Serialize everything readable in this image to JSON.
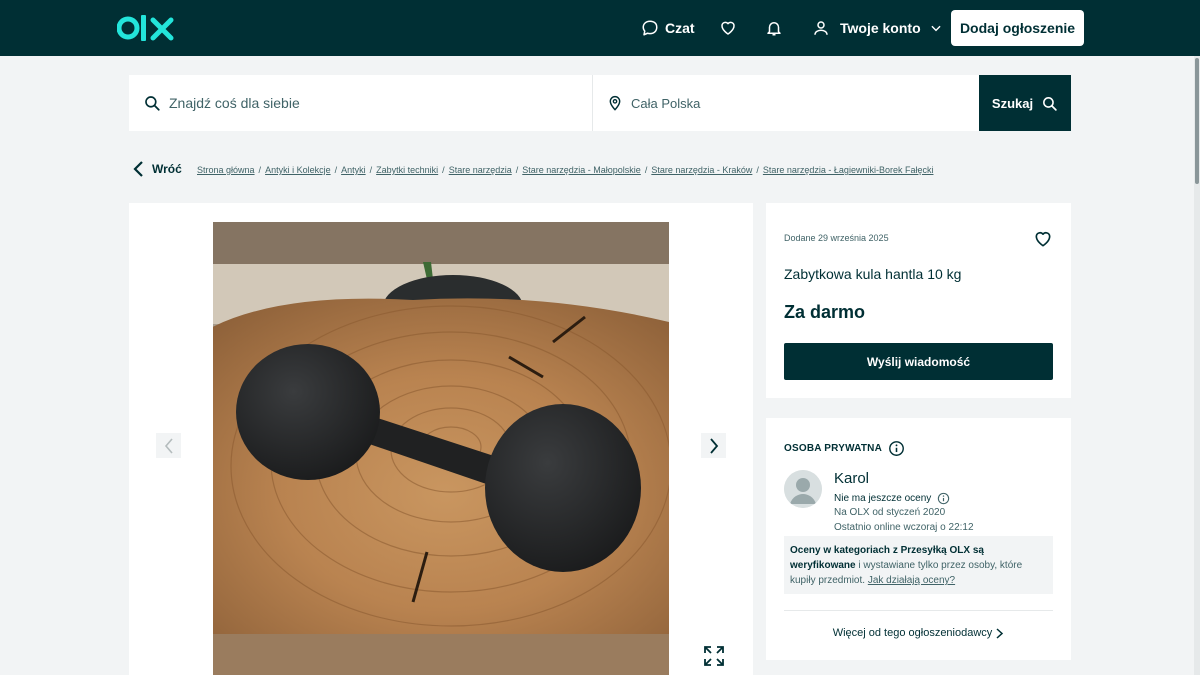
{
  "header": {
    "logo_text": "olx",
    "chat_label": "Czat",
    "account_label": "Twoje konto",
    "add_button_label": "Dodaj ogłoszenie",
    "icons": [
      "chat-icon",
      "heart-icon",
      "bell-icon",
      "user-icon",
      "chevron-down-icon"
    ]
  },
  "search": {
    "query_placeholder": "Znajdź coś dla siebie",
    "location_value": "Cała Polska",
    "button_label": "Szukaj"
  },
  "breadcrumb": {
    "back_label": "Wróć",
    "items": [
      "Strona główna",
      "Antyki i Kolekcje",
      "Antyki",
      "Zabytki techniki",
      "Stare narzędzia",
      "Stare narzędzia - Małopolskie",
      "Stare narzędzia - Kraków",
      "Stare narzędzia - Łagiewniki-Borek Fałęcki"
    ]
  },
  "gallery": {
    "photo_subject": "dumbbell-on-wood-slice"
  },
  "listing": {
    "posted": "Dodane 29 września 2025",
    "title": "Zabytkowa kula hantla 10 kg",
    "price": "Za darmo",
    "message_button": "Wyślij wiadomość"
  },
  "seller": {
    "type": "OSOBA PRYWATNA",
    "name": "Karol",
    "rating": "Nie ma jeszcze oceny",
    "since": "Na OLX od styczeń 2020",
    "last_online": "Ostatnio online wczoraj o 22:12",
    "info_bold": "Oceny w kategoriach z Przesyłką OLX są weryfikowane",
    "info_rest": " i wystawiane tylko przez osoby, które kupiły przedmiot. ",
    "info_link": "Jak działają oceny?",
    "more_link": "Więcej od tego ogłoszeniodawcy"
  },
  "colors": {
    "brand_dark": "#002f34",
    "logo_teal": "#23e5db",
    "background": "#f2f4f5"
  }
}
